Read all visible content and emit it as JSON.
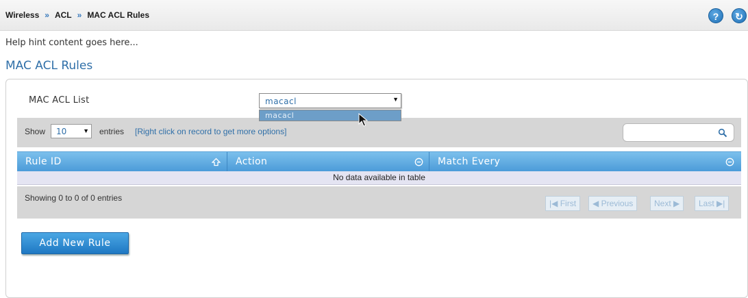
{
  "breadcrumb": {
    "items": [
      "Wireless",
      "ACL",
      "MAC ACL Rules"
    ],
    "separator": "»"
  },
  "header_icons": {
    "help_icon": "?",
    "refresh_icon": "↻"
  },
  "help_hint": "Help hint content goes here...",
  "page_title": "MAC ACL Rules",
  "acl_list": {
    "label": "MAC ACL List",
    "selected": "macacl",
    "options": [
      "macacl"
    ]
  },
  "table_controls": {
    "show_label": "Show",
    "page_size": "10",
    "entries_label": "entries",
    "hint": "[Right click on record to get more options]",
    "search_placeholder": ""
  },
  "table": {
    "columns": [
      "Rule ID",
      "Action",
      "Match Every"
    ],
    "empty_message": "No data available in table",
    "info": "Showing 0 to 0 of 0 entries"
  },
  "pagination": {
    "first": "First",
    "previous": "Previous",
    "next": "Next",
    "last": "Last"
  },
  "add_button": "Add New Rule",
  "colors": {
    "accent": "#2f6fa8",
    "header_blue": "#4a9ad8",
    "band_gray": "#d6d6d6"
  }
}
